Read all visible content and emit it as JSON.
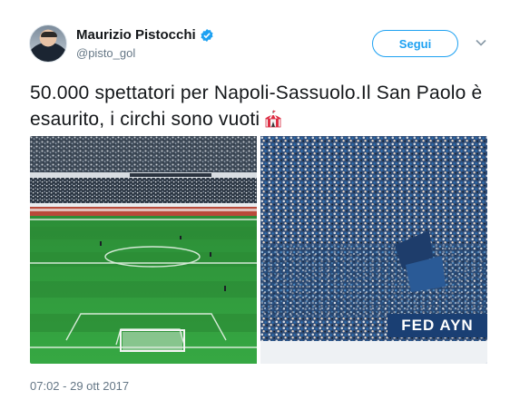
{
  "tweet": {
    "author": {
      "name": "Maurizio Pistocchi",
      "handle": "@pisto_gol",
      "verified": true
    },
    "follow_label": "Segui",
    "text": "50.000 spettatori per Napoli-Sassuolo.Il San Paolo è esaurito, i circhi sono vuoti",
    "emoji": "circus-tent",
    "media": [
      {
        "kind": "photo",
        "subject": "stadium-pitch-stands"
      },
      {
        "kind": "photo",
        "subject": "crowd-banner"
      }
    ],
    "banner_text": "FED AYN",
    "timestamp": "07:02 - 29 ott 2017"
  },
  "colors": {
    "accent": "#1da1f2",
    "text": "#14171a",
    "muted": "#657786",
    "pitch": "#2f9a3c"
  }
}
